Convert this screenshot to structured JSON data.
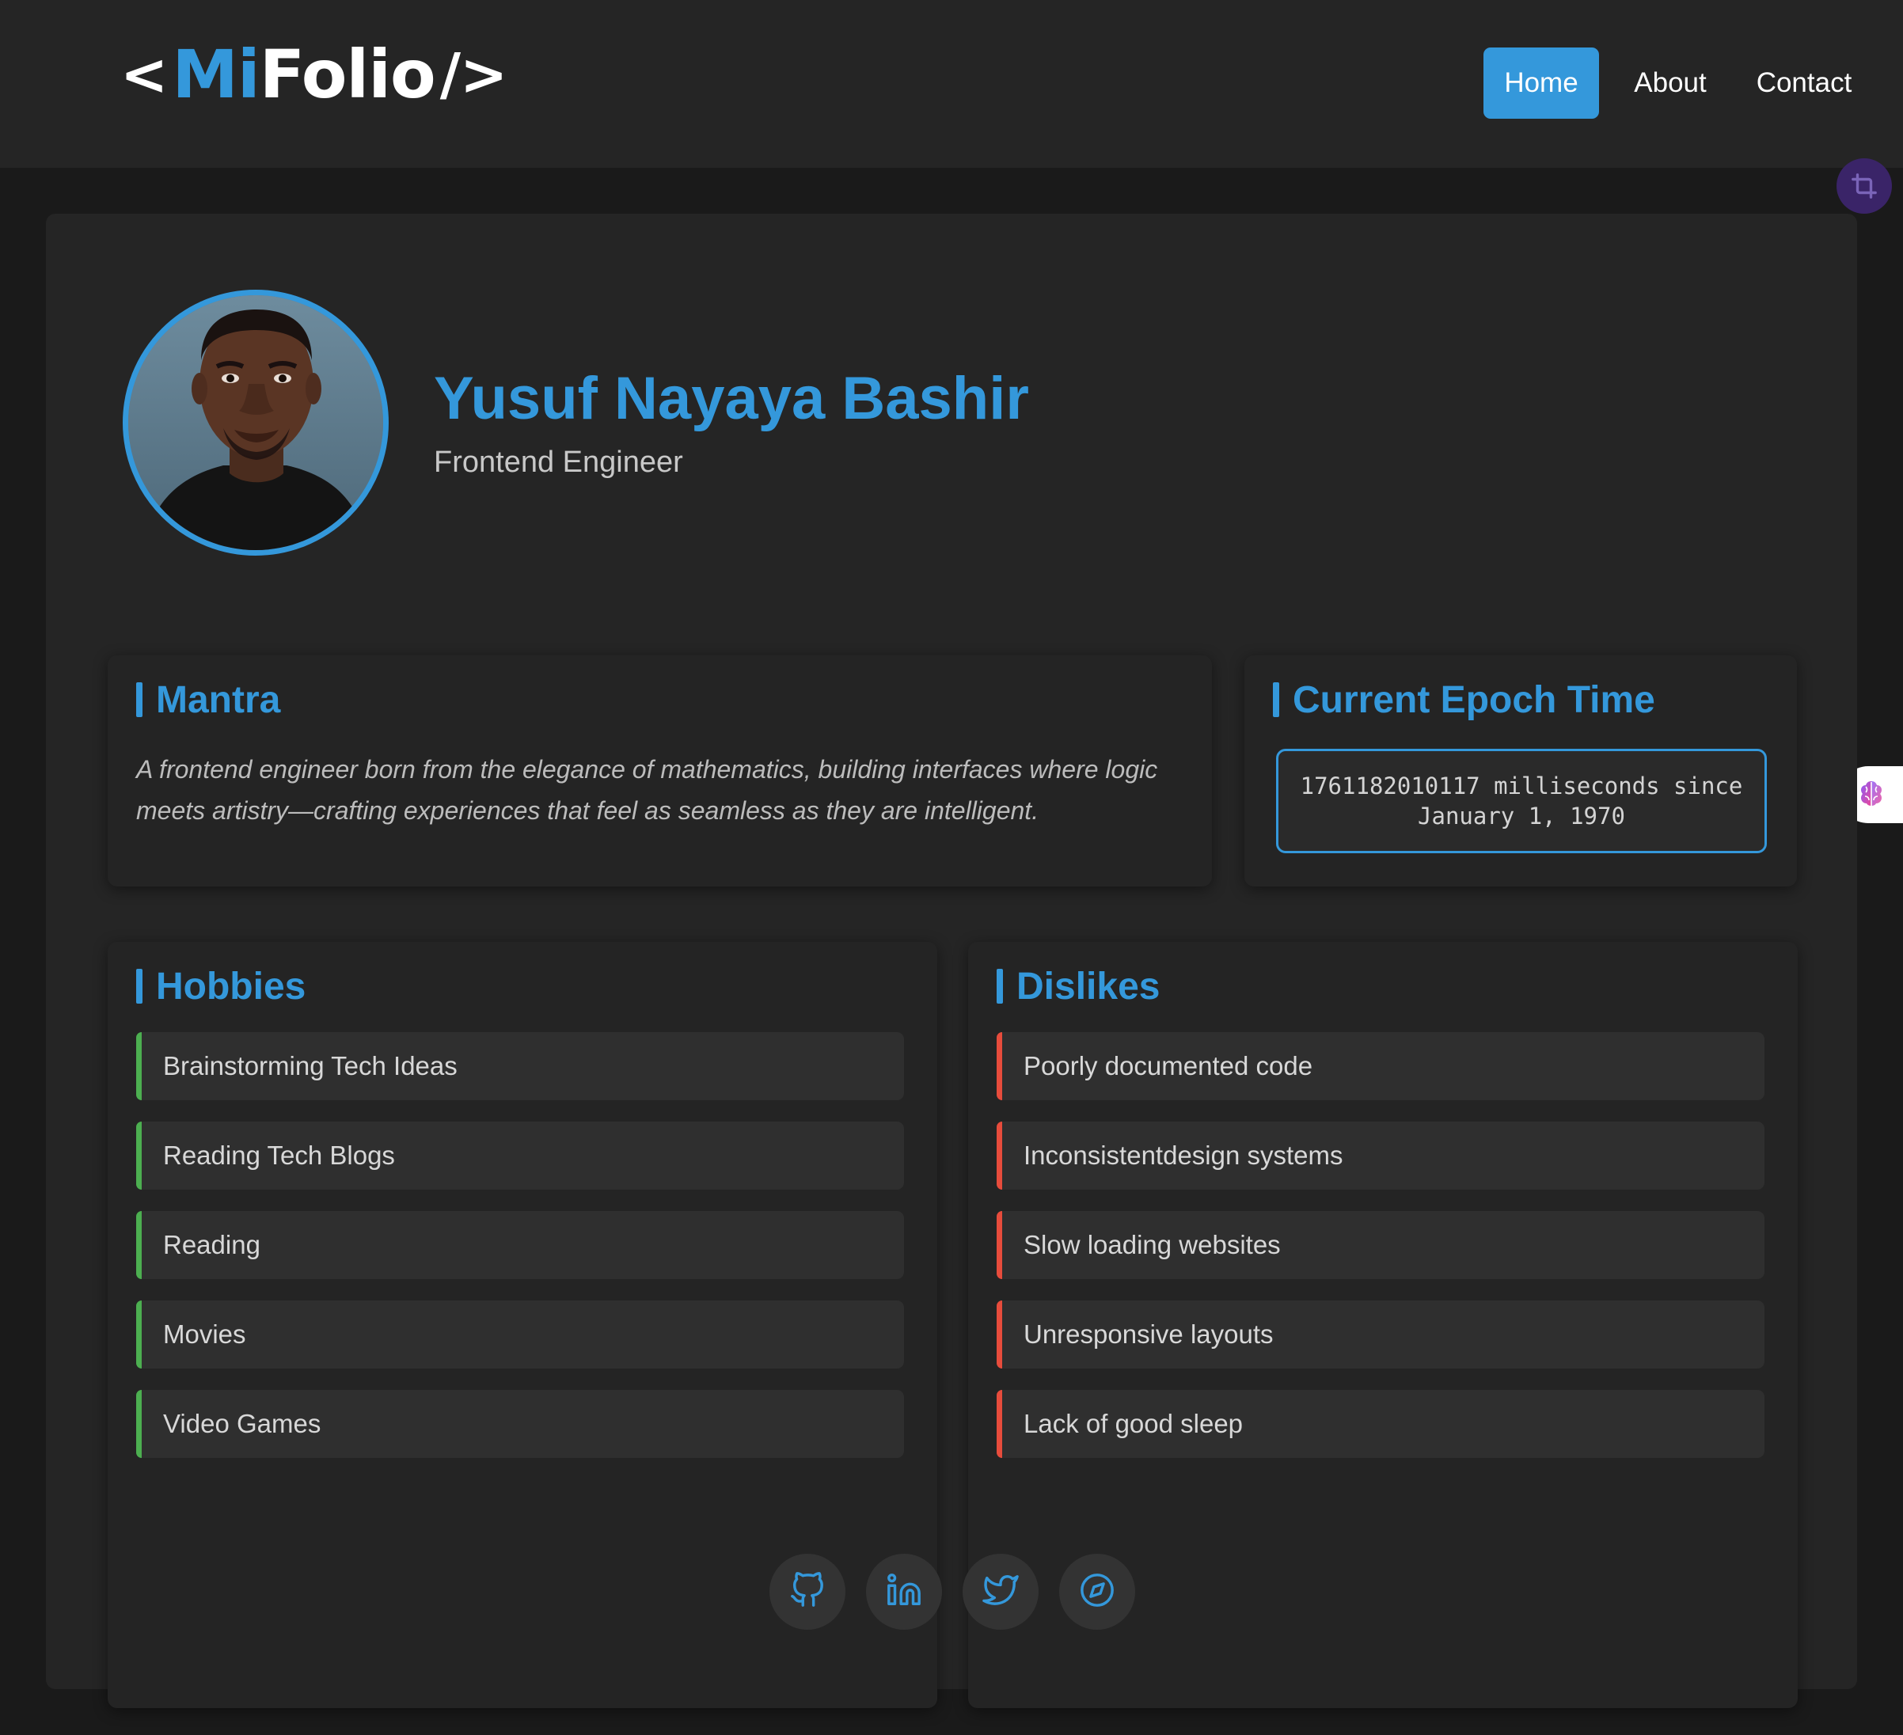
{
  "header": {
    "logo": {
      "open": "<",
      "mi": "Mi",
      "folio": "Folio",
      "close": "/>"
    },
    "nav": [
      {
        "label": "Home",
        "active": true
      },
      {
        "label": "About",
        "active": false
      },
      {
        "label": "Contact",
        "active": false
      }
    ]
  },
  "profile": {
    "name": "Yusuf Nayaya Bashir",
    "role": "Frontend Engineer"
  },
  "mantra": {
    "title": "Mantra",
    "text": "A frontend engineer born from the elegance of mathematics, building interfaces where logic meets artistry—crafting experiences that feel as seamless as they are intelligent."
  },
  "epoch": {
    "title": "Current Epoch Time",
    "line1": "1761182010117 milliseconds since",
    "line2": "January 1, 1970"
  },
  "hobbies": {
    "title": "Hobbies",
    "items": [
      "Brainstorming Tech Ideas",
      "Reading Tech Blogs",
      "Reading",
      "Movies",
      "Video Games"
    ]
  },
  "dislikes": {
    "title": "Dislikes",
    "items": [
      "Poorly documented code",
      "Inconsistentdesign systems",
      "Slow loading websites",
      "Unresponsive layouts",
      "Lack of good sleep"
    ]
  },
  "socials": [
    "github-icon",
    "linkedin-icon",
    "twitter-icon",
    "compass-icon"
  ],
  "colors": {
    "accent": "#3498db",
    "hobby_border": "#4caf50",
    "dislike_border": "#e74c3c",
    "background": "#1a1a1a",
    "surface": "#252525"
  }
}
